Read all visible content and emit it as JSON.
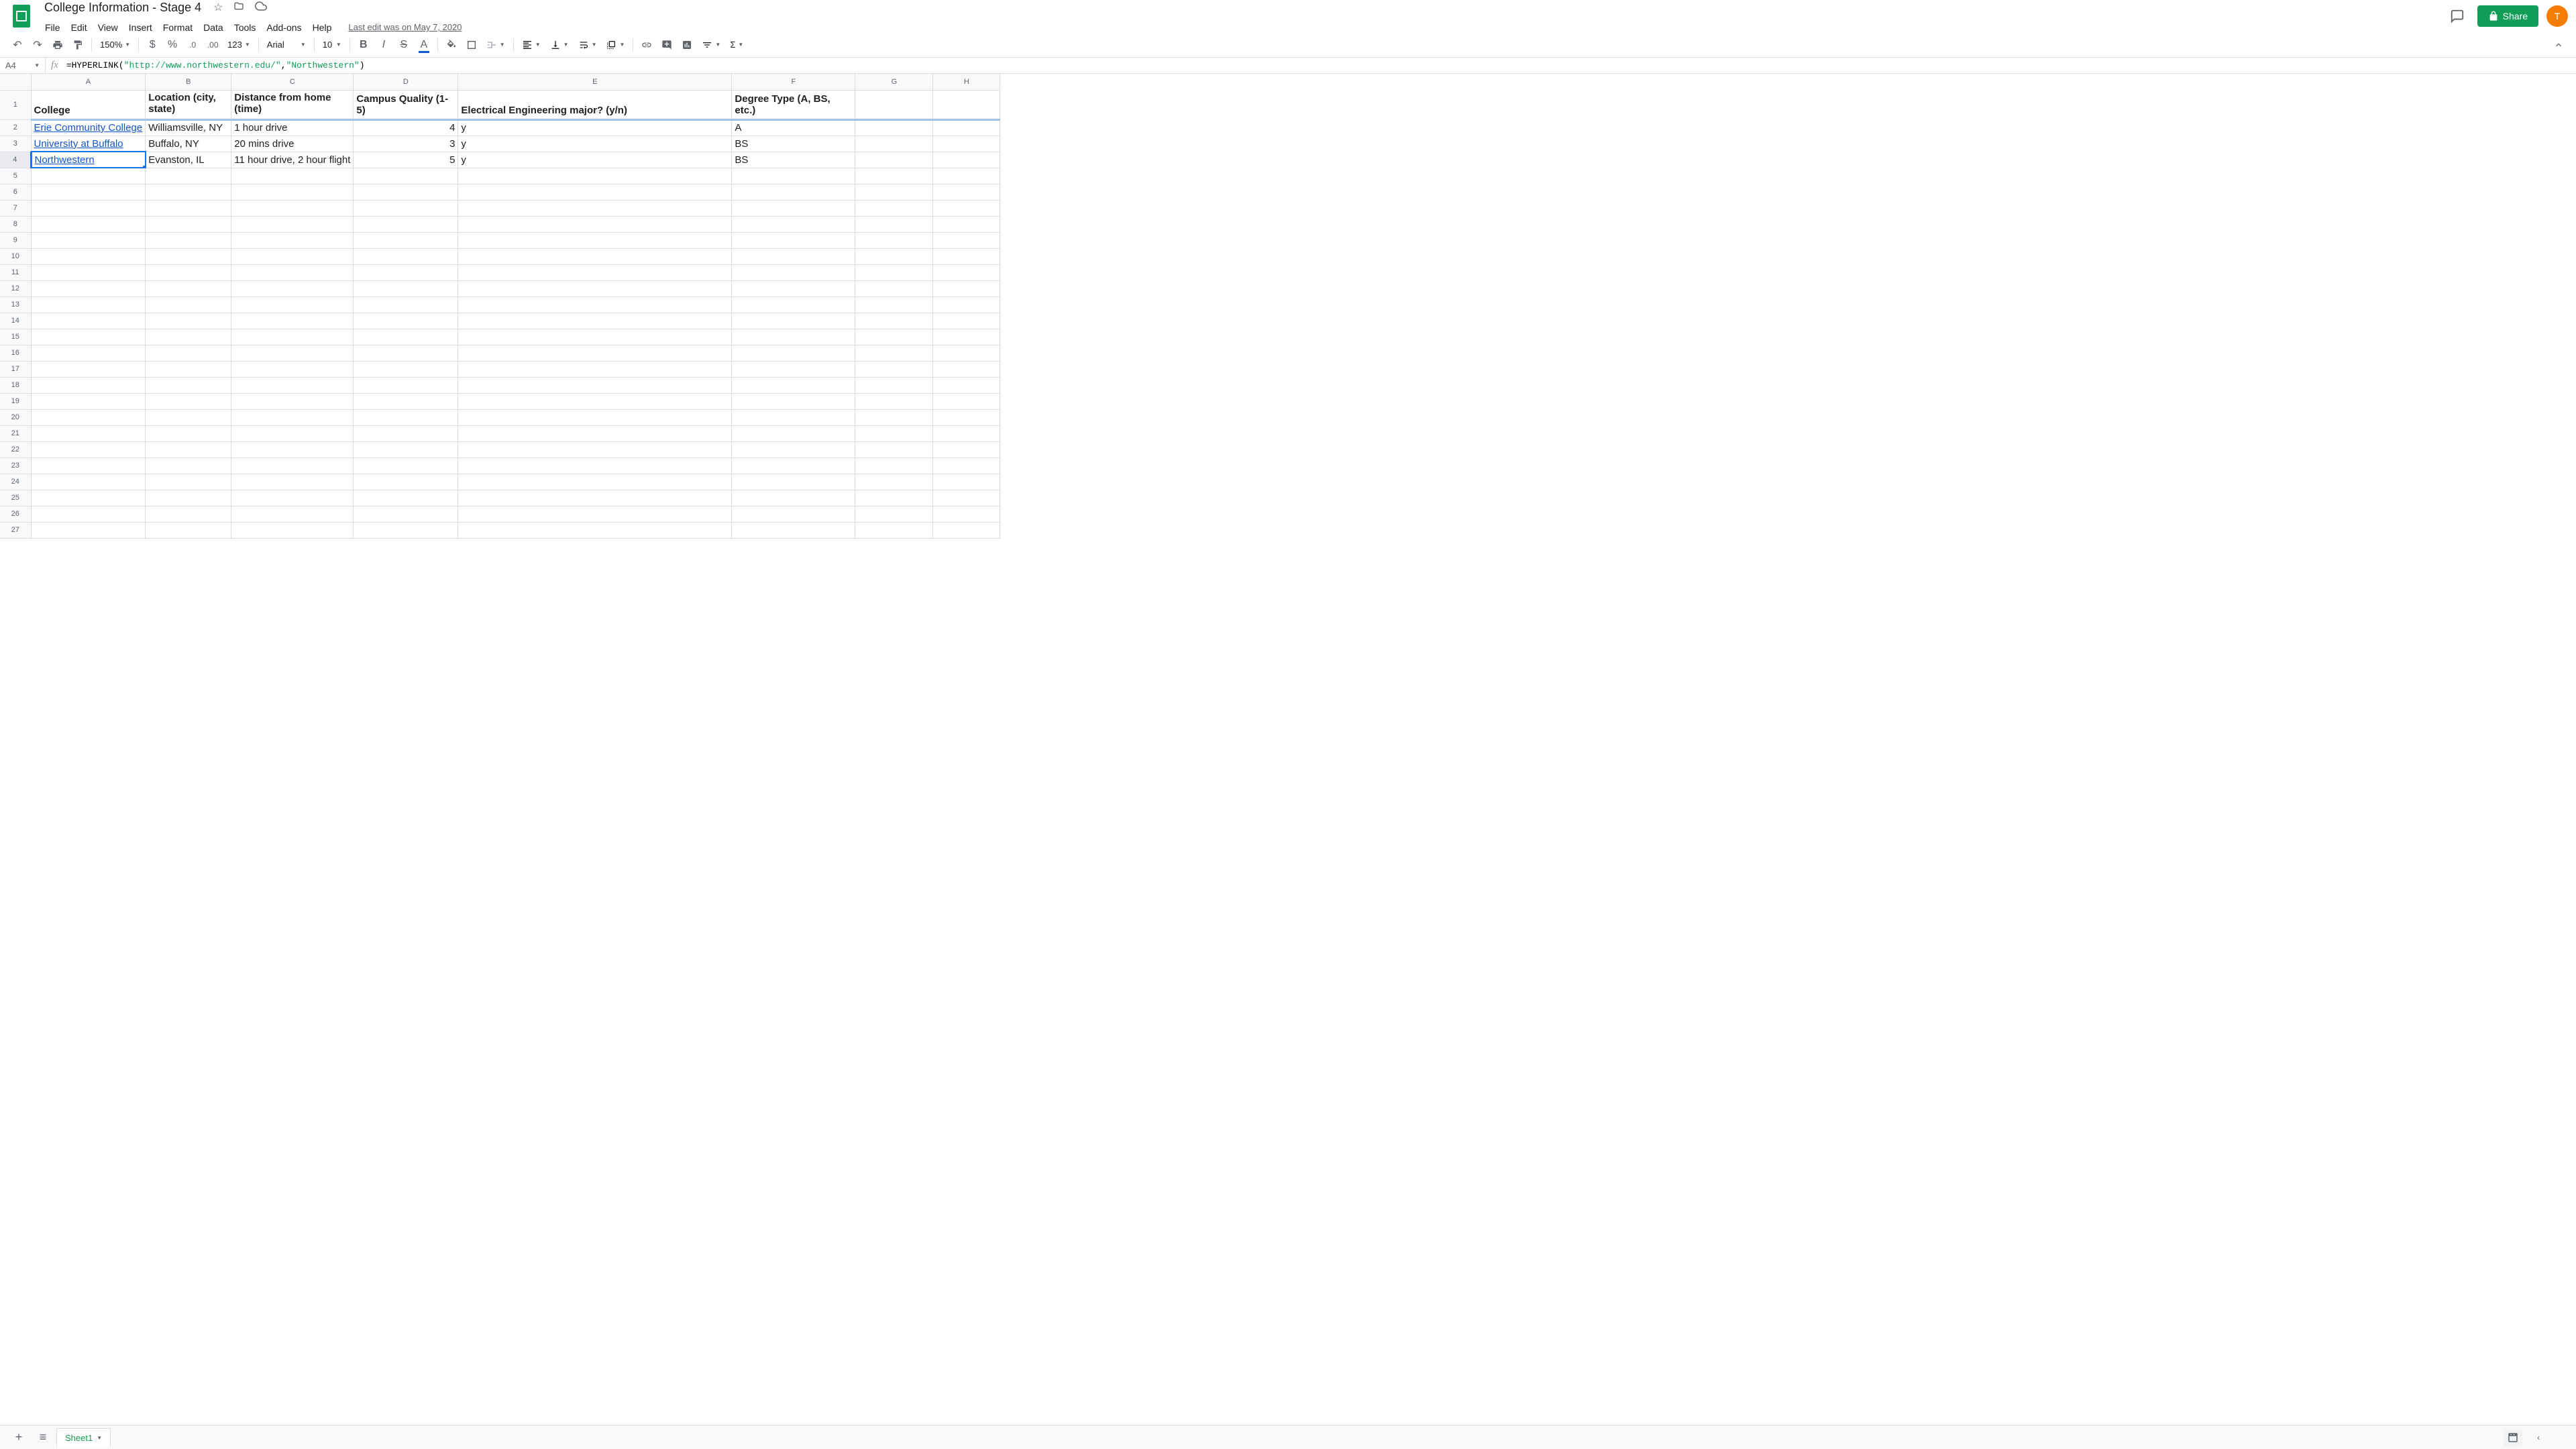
{
  "doc_title": "College Information - Stage 4",
  "last_edit": "Last edit was on May 7, 2020",
  "menu": [
    "File",
    "Edit",
    "View",
    "Insert",
    "Format",
    "Data",
    "Tools",
    "Add-ons",
    "Help"
  ],
  "share_label": "Share",
  "avatar_letter": "T",
  "toolbar": {
    "zoom": "150%",
    "font": "Arial",
    "font_size": "10",
    "format_123": "123"
  },
  "cell_ref": "A4",
  "formula": {
    "prefix": "=HYPERLINK(",
    "arg1": "\"http://www.northwestern.edu/\"",
    "comma": ",",
    "arg2": "\"Northwestern\"",
    "suffix": ")"
  },
  "columns": [
    "A",
    "B",
    "C",
    "D",
    "E",
    "F",
    "G",
    "H"
  ],
  "headers": {
    "A": "College",
    "B": "Location (city, state)",
    "C": "Distance from home (time)",
    "D": "Campus Quality (1-5)",
    "E": "Electrical Engineering major? (y/n)",
    "F": "Degree Type (A, BS, etc.)"
  },
  "rows": [
    {
      "A": "Erie Community College ",
      "A_link": true,
      "B": "Williamsville, NY",
      "C": "1 hour drive",
      "D": "4",
      "E": "y",
      "F": "A"
    },
    {
      "A": "University at Buffalo",
      "A_link": true,
      "B": "Buffalo, NY",
      "C": "20 mins drive",
      "D": "3",
      "E": "y",
      "F": "BS"
    },
    {
      "A": "Northwestern ",
      "A_link": true,
      "B": "Evanston, IL",
      "C": "11 hour drive, 2 hour flight",
      "D": "5",
      "E": "y",
      "F": "BS"
    }
  ],
  "selected_row": 4,
  "total_rows": 27,
  "sheet_tab": "Sheet1"
}
